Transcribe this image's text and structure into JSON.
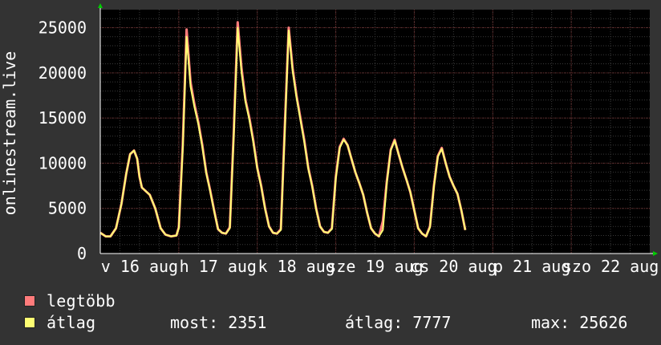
{
  "chart_data": {
    "type": "area",
    "ylabel": "onlinestream.live",
    "ylim": [
      0,
      27000
    ],
    "yticks": [
      0,
      5000,
      10000,
      15000,
      20000,
      25000
    ],
    "x_tick_labels": [
      "v 16 aug",
      "h 17 aug",
      "k 18 aug",
      "sze 19 aug",
      "cs 20 aug",
      "p 21 aug",
      "szo 22 aug"
    ],
    "x": [
      0.0,
      0.07,
      0.13,
      0.2,
      0.27,
      0.33,
      0.38,
      0.43,
      0.47,
      0.5,
      0.53,
      0.58,
      0.63,
      0.7,
      0.77,
      0.83,
      0.9,
      0.97,
      1.0,
      1.05,
      1.1,
      1.15,
      1.2,
      1.25,
      1.3,
      1.35,
      1.4,
      1.45,
      1.5,
      1.55,
      1.6,
      1.65,
      1.7,
      1.75,
      1.8,
      1.85,
      1.9,
      1.95,
      2.0,
      2.05,
      2.1,
      2.15,
      2.2,
      2.25,
      2.3,
      2.35,
      2.4,
      2.45,
      2.5,
      2.55,
      2.6,
      2.65,
      2.7,
      2.75,
      2.8,
      2.85,
      2.9,
      2.95,
      3.0,
      3.05,
      3.1,
      3.15,
      3.2,
      3.25,
      3.3,
      3.35,
      3.4,
      3.45,
      3.5,
      3.55,
      3.6,
      3.65,
      3.7,
      3.75,
      3.8,
      3.85,
      3.9,
      3.95,
      4.0,
      4.05,
      4.1,
      4.15,
      4.2,
      4.25,
      4.3,
      4.35,
      4.4,
      4.45,
      4.5,
      4.55,
      4.6,
      4.65,
      4.7,
      4.75,
      4.8,
      4.85,
      4.9,
      4.95,
      5.0,
      5.05,
      5.1,
      5.15,
      5.2,
      5.25,
      5.3,
      5.35,
      5.4,
      5.45,
      5.5,
      5.55,
      5.6,
      5.65,
      5.7,
      5.75,
      5.8,
      5.85,
      5.9,
      5.95,
      6.0,
      6.05,
      6.1,
      6.15,
      6.2,
      6.25,
      6.3,
      6.35,
      6.4,
      6.45,
      6.5,
      6.55,
      6.6,
      6.65,
      6.7,
      6.75,
      6.8,
      6.85,
      6.9,
      6.95,
      7.0
    ],
    "series": [
      {
        "name": "legtöbb",
        "color": "#ff7b7b",
        "values": [
          2300,
          1900,
          1900,
          2800,
          5500,
          8800,
          11000,
          11400,
          10500,
          8500,
          7300,
          6900,
          6500,
          5000,
          2800,
          2100,
          1900,
          2000,
          2900,
          12000,
          24800,
          19000,
          16500,
          14500,
          12000,
          9000,
          7000,
          4800,
          2700,
          2300,
          2200,
          2900,
          13500,
          25600,
          20500,
          17000,
          15000,
          12500,
          9500,
          7500,
          5000,
          3000,
          2300,
          2200,
          2700,
          14000,
          25000,
          20500,
          17500,
          15000,
          12500,
          9500,
          7500,
          5000,
          3000,
          2400,
          2300,
          2800,
          8500,
          11800,
          12700,
          12000,
          10500,
          9000,
          7800,
          6500,
          4500,
          2800,
          2200,
          1900,
          3600,
          8000,
          11500,
          12600,
          11000,
          9500,
          8200,
          6800,
          4800,
          2800,
          2200,
          1900,
          3000,
          7500,
          10800,
          11700,
          10000,
          8500,
          7500,
          6600,
          4800,
          2600
        ]
      },
      {
        "name": "átlag",
        "color": "#ffff73",
        "values": [
          2300,
          1900,
          1900,
          2800,
          5500,
          8800,
          11000,
          11400,
          10500,
          8500,
          7300,
          6900,
          6500,
          5000,
          2800,
          2100,
          1900,
          2000,
          2800,
          11500,
          24000,
          18500,
          16200,
          14300,
          11800,
          8900,
          6900,
          4700,
          2700,
          2300,
          2200,
          2800,
          13000,
          25000,
          20000,
          16800,
          14800,
          12300,
          9400,
          7400,
          4900,
          3000,
          2300,
          2200,
          2600,
          13500,
          24700,
          20200,
          17300,
          14800,
          12300,
          9400,
          7400,
          4900,
          3000,
          2400,
          2300,
          2700,
          8300,
          11700,
          12600,
          12000,
          10500,
          9000,
          7800,
          6500,
          4500,
          2800,
          2200,
          1900,
          2600,
          7800,
          11400,
          12500,
          11000,
          9500,
          8200,
          6800,
          4800,
          2800,
          2200,
          1900,
          2900,
          7400,
          10700,
          11600,
          10000,
          8500,
          7500,
          6600,
          4800,
          2600
        ]
      }
    ]
  },
  "legend": {
    "max_label": "legtöbb",
    "max_color": "#ff7b7b",
    "avg_label": "átlag",
    "avg_color": "#ffff73"
  },
  "stats": {
    "current": "most: 2351",
    "average": "átlag: 7777",
    "maximum": "max: 25626"
  }
}
